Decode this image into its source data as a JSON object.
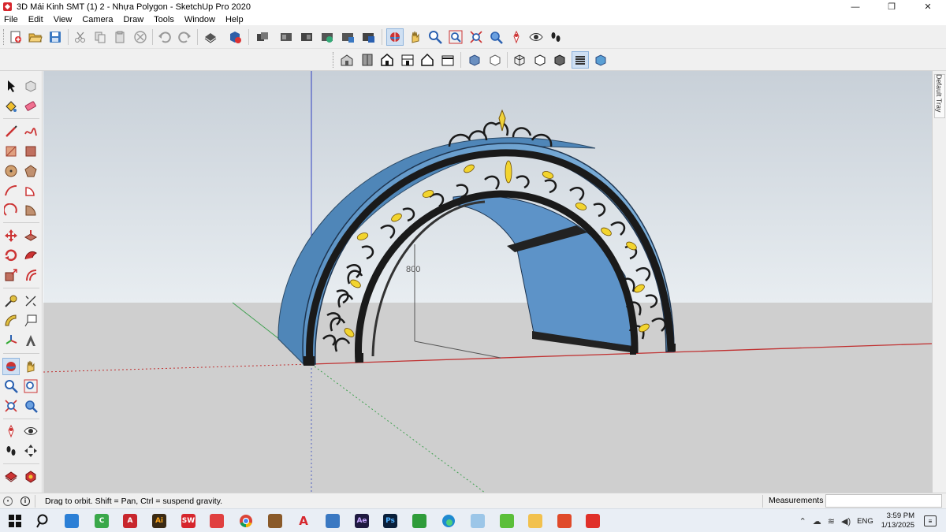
{
  "window": {
    "title": "3D Mái Kinh SMT (1) 2 - Nhựa Polygon - SketchUp Pro 2020",
    "minimize_symbol": "—",
    "restore_symbol": "❐",
    "close_symbol": "✕"
  },
  "menu": {
    "items": [
      "File",
      "Edit",
      "View",
      "Camera",
      "Draw",
      "Tools",
      "Window",
      "Help"
    ]
  },
  "toolbar_top": {
    "buttons": [
      "new-icon",
      "open-icon",
      "save-icon",
      "cut-icon",
      "copy-icon",
      "paste-icon",
      "erase-icon",
      "undo-icon",
      "redo-icon",
      "print-icon",
      "model-info-icon",
      "make-component-icon",
      "paint-bucket-icon",
      "tape-measure-icon",
      "sandbox-icon",
      "section-icon",
      "orbit-icon",
      "pan-icon",
      "zoom-icon",
      "zoom-window-icon",
      "zoom-extents-icon",
      "previous-view-icon",
      "position-camera-icon",
      "look-around-icon",
      "walk-icon"
    ]
  },
  "toolbar_views": {
    "buttons": [
      "iso-view-icon",
      "top-view-icon",
      "front-view-icon",
      "right-view-icon",
      "back-view-icon",
      "left-view-icon",
      "xray-icon",
      "back-edges-icon",
      "wireframe-icon",
      "hidden-line-icon",
      "shaded-icon",
      "shaded-textures-icon",
      "monochrome-icon"
    ]
  },
  "left_toolbar": {
    "buttons": [
      "select-icon",
      "make-component-icon",
      "paint-bucket-icon",
      "eraser-icon",
      "line-icon",
      "freehand-icon",
      "rectangle-icon",
      "rotated-rectangle-icon",
      "circle-icon",
      "polygon-icon",
      "arc-icon",
      "pie-icon",
      "two-point-arc-icon",
      "three-point-arc-icon",
      "move-icon",
      "push-pull-icon",
      "rotate-icon",
      "follow-me-icon",
      "scale-icon",
      "offset-icon",
      "tape-measure-icon",
      "dimension-icon",
      "protractor-icon",
      "text-icon",
      "axes-icon",
      "3d-text-icon",
      "orbit-icon",
      "pan-icon",
      "zoom-icon",
      "zoom-window-icon",
      "zoom-extents-icon",
      "previous-icon",
      "position-camera-icon",
      "look-around-icon",
      "walk-icon",
      "section-plane-icon",
      "warehouse-icon",
      "extension-icon"
    ]
  },
  "viewport": {
    "dimension_label": "800"
  },
  "tray": {
    "label": "Default Tray"
  },
  "status": {
    "message": "Drag to orbit. Shift = Pan, Ctrl = suspend gravity.",
    "measurements_label": "Measurements",
    "measurements_value": ""
  },
  "taskbar": {
    "apps": [
      "windows-start-icon",
      "search-icon",
      "vscode-icon",
      "camtasia-icon",
      "autocad-icon",
      "illustrator-icon",
      "solidworks-icon",
      "sketchup-layout-icon",
      "chrome-icon",
      "app-icon",
      "acrobat-icon",
      "calculator-icon",
      "after-effects-icon",
      "photoshop-icon",
      "coreldraw-icon",
      "edge-icon",
      "paint-icon",
      "zalo-icon",
      "file-explorer-icon",
      "vray-icon",
      "sketchup-icon"
    ],
    "language": "ENG",
    "time": "3:59 PM",
    "date": "1/13/2025"
  }
}
